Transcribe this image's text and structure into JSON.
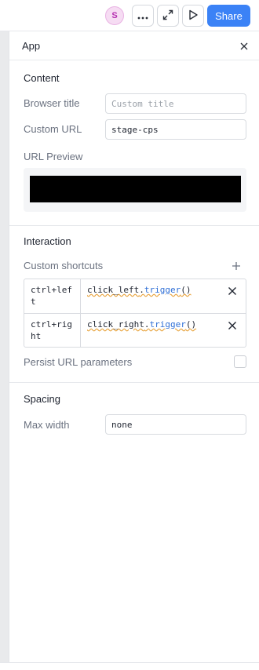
{
  "toolbar": {
    "avatar_initial": "S",
    "share_label": "Share",
    "icons": [
      "more-icon",
      "expand-icon",
      "play-icon"
    ]
  },
  "panel": {
    "title": "App",
    "content": {
      "heading": "Content",
      "browser_title_label": "Browser title",
      "browser_title_placeholder": "Custom title",
      "custom_url_label": "Custom URL",
      "custom_url_value": "stage-cps",
      "url_preview_label": "URL Preview"
    },
    "interaction": {
      "heading": "Interaction",
      "shortcuts_label": "Custom shortcuts",
      "shortcuts": [
        {
          "key": "ctrl+left",
          "fn": "click_left",
          "dot": ".",
          "method": "trigger",
          "call": "()"
        },
        {
          "key": "ctrl+right",
          "fn": "click_right",
          "dot": ".",
          "method": "trigger",
          "call": "()"
        }
      ],
      "persist_label": "Persist URL parameters",
      "persist_checked": false
    },
    "spacing": {
      "heading": "Spacing",
      "max_width_label": "Max width",
      "max_width_value": "none"
    }
  },
  "colors": {
    "accent": "#3b82f6",
    "avatar_bg": "#f6dcf3",
    "avatar_fg": "#b52fb0"
  }
}
